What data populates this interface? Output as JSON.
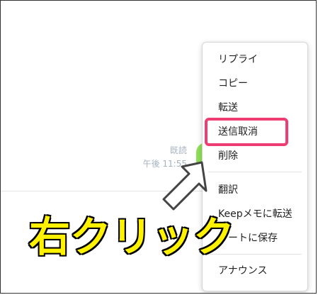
{
  "chat": {
    "read_label": "既読",
    "timestamp": "午後 11:55",
    "bubble_color": "#8de055"
  },
  "context_menu": {
    "items": [
      {
        "label": "リプライ"
      },
      {
        "label": "コピー"
      },
      {
        "label": "転送"
      },
      {
        "label": "送信取消"
      },
      {
        "label": "削除"
      },
      {
        "label": "翻訳"
      },
      {
        "label": "Keepメモに転送"
      },
      {
        "label": "ノートに保存"
      },
      {
        "label": "アナウンス"
      }
    ],
    "highlighted_item": "送信取消",
    "highlight_color": "#ee3d72"
  },
  "annotation": {
    "callout_text": "右クリック",
    "callout_color": "#fff200",
    "arrow_icon": "arrow-up-right-icon"
  }
}
